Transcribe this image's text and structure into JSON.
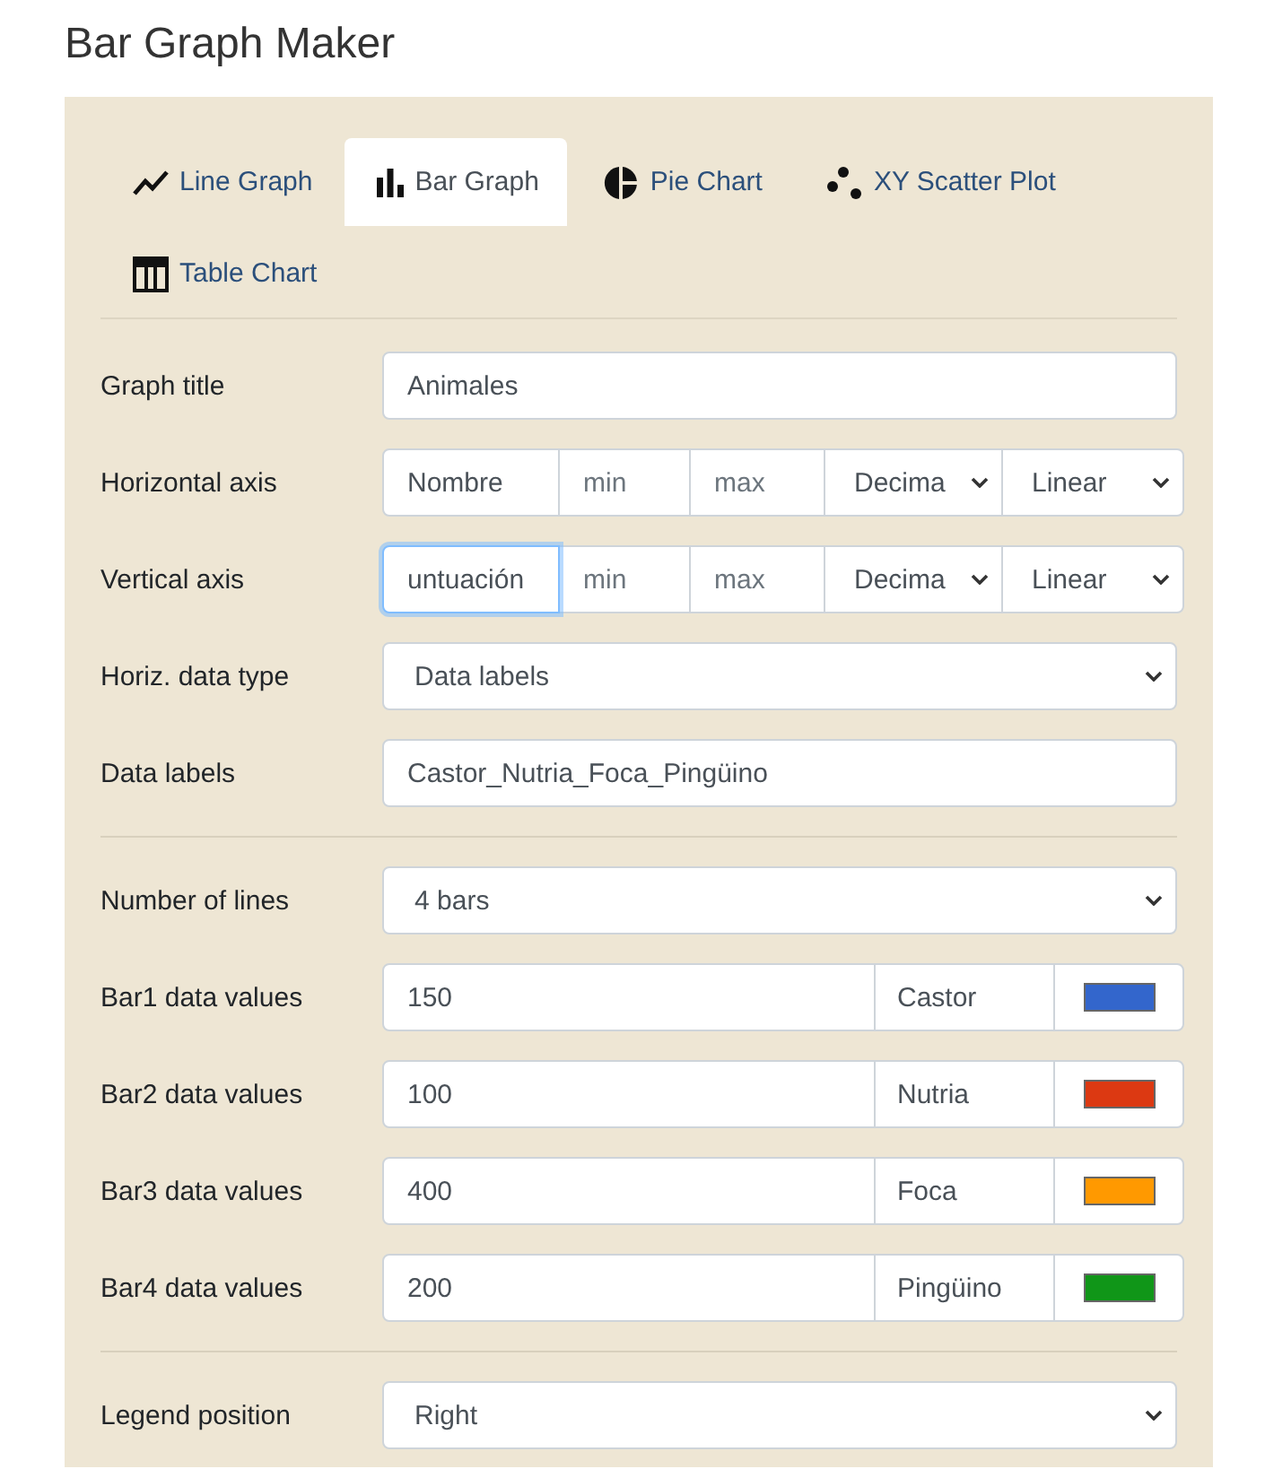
{
  "title": "Bar Graph Maker",
  "tabs": [
    {
      "kind": "line",
      "label": "Line Graph",
      "selected": false
    },
    {
      "kind": "bar",
      "label": "Bar Graph",
      "selected": true
    },
    {
      "kind": "pie",
      "label": "Pie Chart",
      "selected": false
    },
    {
      "kind": "scatter",
      "label": "XY Scatter Plot",
      "selected": false
    },
    {
      "kind": "table",
      "label": "Table Chart",
      "selected": false
    }
  ],
  "sections": [
    {
      "rows": [
        {
          "kind": "text",
          "label": "Graph title",
          "value": "Animales"
        },
        {
          "kind": "axis",
          "label": "Horizontal axis",
          "name": "Nombre",
          "focused": false,
          "min": {
            "placeholder": "min"
          },
          "max": {
            "placeholder": "max"
          },
          "format": "Decima",
          "scale": "Linear"
        },
        {
          "kind": "axis",
          "label": "Vertical axis",
          "name": "untuación",
          "focused": true,
          "min": {
            "placeholder": "min"
          },
          "max": {
            "placeholder": "max"
          },
          "format": "Decima",
          "scale": "Linear"
        },
        {
          "kind": "select",
          "label": "Horiz. data type",
          "value": "Data labels"
        },
        {
          "kind": "text",
          "label": "Data labels",
          "value": "Castor_Nutria_Foca_Pingüino"
        }
      ]
    },
    {
      "rows": [
        {
          "kind": "select",
          "label": "Number of lines",
          "value": "4 bars"
        },
        {
          "kind": "series",
          "label": "Bar1 data values",
          "values": "150",
          "name": "Castor",
          "color": "#3366cc"
        },
        {
          "kind": "series",
          "label": "Bar2 data values",
          "values": "100",
          "name": "Nutria",
          "color": "#dc3912"
        },
        {
          "kind": "series",
          "label": "Bar3 data values",
          "values": "400",
          "name": "Foca",
          "color": "#ff9900"
        },
        {
          "kind": "series",
          "label": "Bar4 data values",
          "values": "200",
          "name": "Pingüino",
          "color": "#109618"
        }
      ]
    },
    {
      "rows": [
        {
          "kind": "select",
          "label": "Legend position",
          "value": "Right"
        }
      ]
    }
  ]
}
